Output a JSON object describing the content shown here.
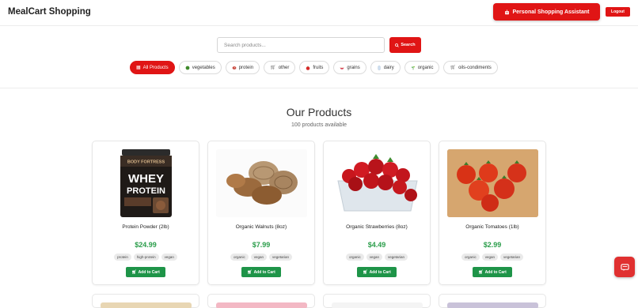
{
  "header": {
    "brand": "MealCart Shopping",
    "assistant_label": "Personal Shopping Assistant",
    "logout_label": "Logout"
  },
  "search": {
    "placeholder": "Search products...",
    "button_label": "Search"
  },
  "categories": [
    {
      "label": "All Products",
      "icon": "grid-icon",
      "active": true
    },
    {
      "label": "vegetables",
      "icon": "vegetable-icon"
    },
    {
      "label": "protein",
      "icon": "meat-icon"
    },
    {
      "label": "other",
      "icon": "cart-icon"
    },
    {
      "label": "fruits",
      "icon": "apple-icon"
    },
    {
      "label": "grains",
      "icon": "bowl-icon"
    },
    {
      "label": "dairy",
      "icon": "milk-icon"
    },
    {
      "label": "organic",
      "icon": "sprout-icon"
    },
    {
      "label": "oils-condiments",
      "icon": "cart-icon"
    }
  ],
  "section": {
    "title": "Our Products",
    "count_text": "100 products available"
  },
  "products": [
    {
      "name": "Protein Powder (2lb)",
      "price": "$24.99",
      "tags": [
        "protein",
        "high-protein",
        "vegan"
      ],
      "button": "Add to Cart",
      "image": "protein-powder-tub"
    },
    {
      "name": "Organic Walnuts (8oz)",
      "price": "$7.99",
      "tags": [
        "organic",
        "vegan",
        "vegetarian"
      ],
      "button": "Add to Cart",
      "image": "walnuts"
    },
    {
      "name": "Organic Strawberries (8oz)",
      "price": "$4.49",
      "tags": [
        "organic",
        "vegan",
        "vegetarian"
      ],
      "button": "Add to Cart",
      "image": "strawberries"
    },
    {
      "name": "Organic Tomatoes (1lb)",
      "price": "$2.99",
      "tags": [
        "organic",
        "vegan",
        "vegetarian"
      ],
      "button": "Add to Cart",
      "image": "tomatoes"
    }
  ],
  "product_image_text": {
    "brand_top": "BODY FORTRESS",
    "line1": "WHEY",
    "line2": "PROTEIN"
  },
  "icons": {
    "assistant": "robot-icon",
    "search": "search-icon",
    "cart": "cart-icon",
    "chat": "chat-icon"
  },
  "colors": {
    "accent": "#e01515",
    "price": "#2a9d4a",
    "cart_button": "#1e9448"
  }
}
